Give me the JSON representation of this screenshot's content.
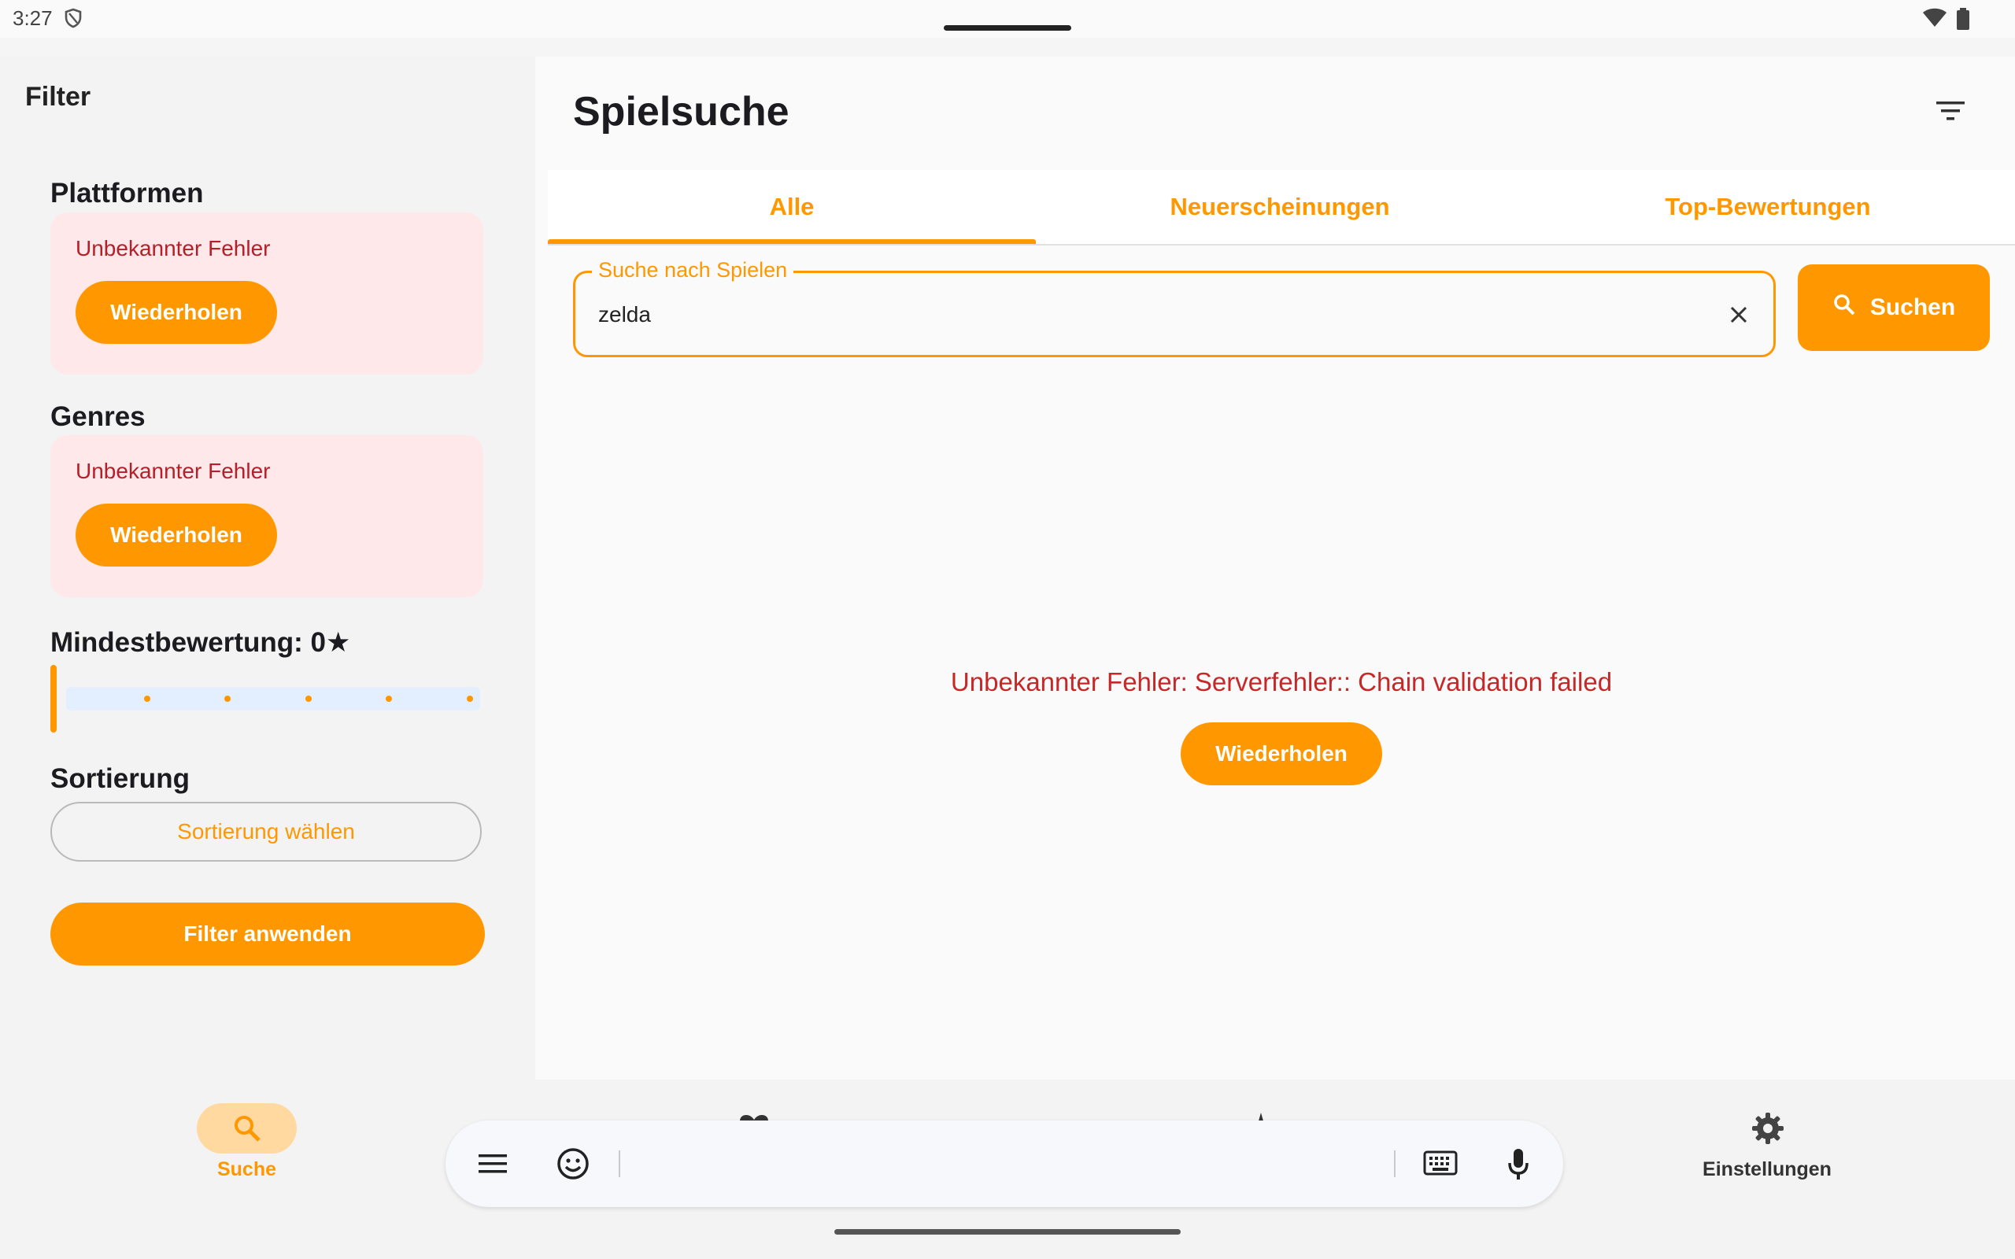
{
  "status_bar": {
    "time": "3:27"
  },
  "filter_panel": {
    "title": "Filter",
    "platforms": {
      "title": "Plattformen",
      "error": "Unbekannter Fehler",
      "retry_label": "Wiederholen"
    },
    "genres": {
      "title": "Genres",
      "error": "Unbekannter Fehler",
      "retry_label": "Wiederholen"
    },
    "rating": {
      "title": "Mindestbewertung: 0★",
      "value": 0,
      "max": 5
    },
    "sorting": {
      "title": "Sortierung",
      "button_label": "Sortierung wählen"
    },
    "apply_label": "Filter anwenden"
  },
  "main": {
    "title": "Spielsuche",
    "tabs": [
      {
        "label": "Alle",
        "selected": true
      },
      {
        "label": "Neuerscheinungen",
        "selected": false
      },
      {
        "label": "Top-Bewertungen",
        "selected": false
      }
    ],
    "search": {
      "label": "Suche nach Spielen",
      "value": "zelda",
      "button_label": "Suchen"
    },
    "error_message": "Unbekannter Fehler: Serverfehler:: Chain validation failed",
    "retry_label": "Wiederholen"
  },
  "bottom_nav": {
    "items": [
      {
        "label": "Suche",
        "icon": "search-icon",
        "selected": true
      },
      {
        "label": "Einstellungen",
        "icon": "gear-icon",
        "selected": false
      }
    ]
  },
  "colors": {
    "accent": "#ff9800",
    "error": "#c62828",
    "error_bg": "#ffe8ea"
  }
}
